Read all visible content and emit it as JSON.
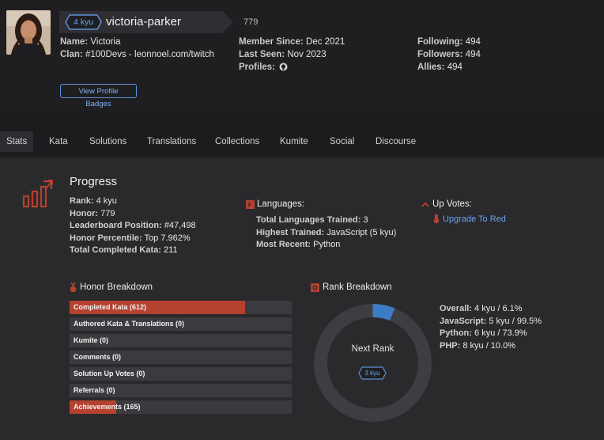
{
  "profile": {
    "rank": "4 kyu",
    "username": "victoria-parker",
    "honor": "779",
    "name_label": "Name:",
    "name_value": "Victoria",
    "clan_label": "Clan:",
    "clan_value": "#100Devs - leonnoel.com/twitch",
    "member_since_label": "Member Since:",
    "member_since_value": "Dec 2021",
    "last_seen_label": "Last Seen:",
    "last_seen_value": "Nov 2023",
    "profiles_label": "Profiles:",
    "following_label": "Following:",
    "following_value": "494",
    "followers_label": "Followers:",
    "followers_value": "494",
    "allies_label": "Allies:",
    "allies_value": "494",
    "badges_button": "View Profile Badges"
  },
  "tabs": [
    "Stats",
    "Kata",
    "Solutions",
    "Translations",
    "Collections",
    "Kumite",
    "Social",
    "Discourse"
  ],
  "progress": {
    "title": "Progress",
    "rank_label": "Rank:",
    "rank_value": "4 kyu",
    "honor_label": "Honor:",
    "honor_value": "779",
    "leaderboard_label": "Leaderboard Position:",
    "leaderboard_value": "#47,498",
    "percentile_label": "Honor Percentile:",
    "percentile_value": "Top 7.962%",
    "completed_label": "Total Completed Kata:",
    "completed_value": "211"
  },
  "languages": {
    "title": "Languages:",
    "total_label": "Total Languages Trained:",
    "total_value": "3",
    "highest_label": "Highest Trained:",
    "highest_value": "JavaScript (5 kyu)",
    "recent_label": "Most Recent:",
    "recent_value": "Python"
  },
  "upvotes": {
    "title": "Up Votes:",
    "link": "Upgrade To Red"
  },
  "honor_breakdown": {
    "title": "Honor Breakdown",
    "items": [
      {
        "label": "Completed Kata (612)",
        "fill": 0.79
      },
      {
        "label": "Authored Kata & Translations (0)",
        "fill": 0
      },
      {
        "label": "Kumite (0)",
        "fill": 0
      },
      {
        "label": "Comments (0)",
        "fill": 0
      },
      {
        "label": "Solution Up Votes (0)",
        "fill": 0
      },
      {
        "label": "Referrals (0)",
        "fill": 0
      },
      {
        "label": "Achievements (165)",
        "fill": 0.21
      }
    ]
  },
  "rank_breakdown": {
    "title": "Rank Breakdown",
    "center_label": "Next Rank",
    "next_rank": "3 kyu",
    "progress_fraction": 0.061,
    "overall_label": "Overall:",
    "overall_value": "4 kyu / 6.1%",
    "javascript_label": "JavaScript:",
    "javascript_value": "5 kyu / 99.5%",
    "python_label": "Python:",
    "python_value": "6 kyu / 73.9%",
    "php_label": "PHP:",
    "php_value": "8 kyu / 10.0%"
  },
  "colors": {
    "accent_red": "#b5412f",
    "accent_blue": "#3d7bc4",
    "link_blue": "#6aa3f0"
  }
}
